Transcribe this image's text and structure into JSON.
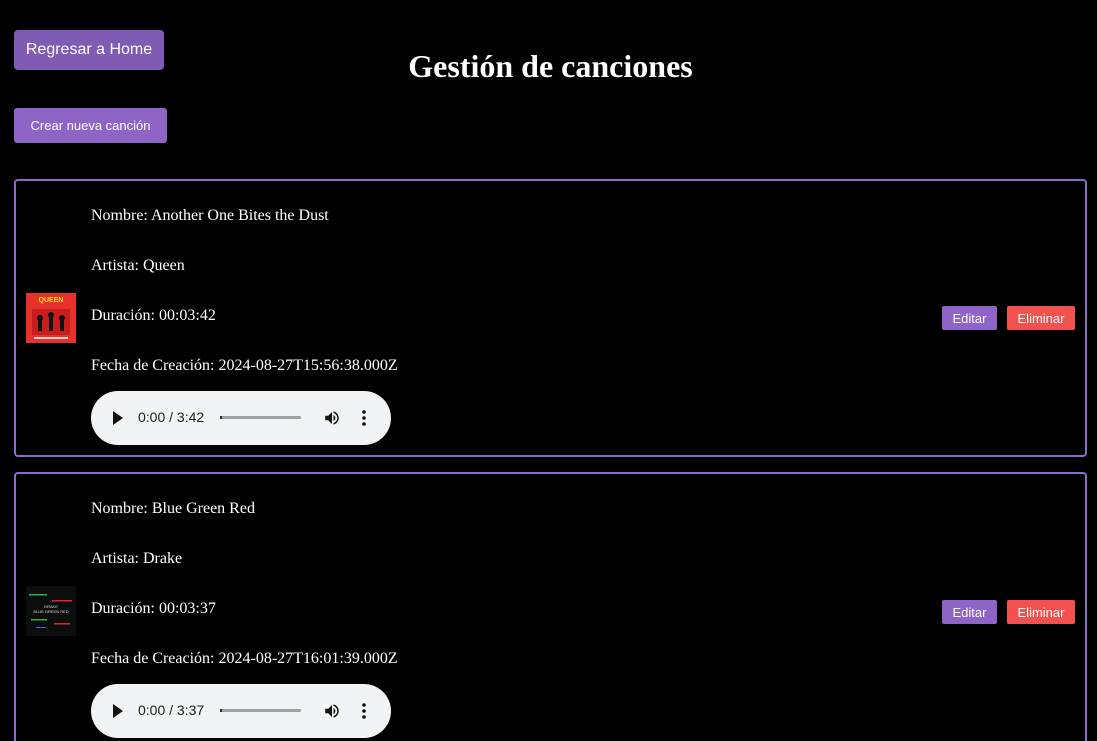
{
  "header": {
    "home_button": "Regresar a Home",
    "title": "Gestión de canciones",
    "create_button": "Crear nueva canción"
  },
  "songs": [
    {
      "name": "Nombre: Another One Bites the Dust",
      "artist": "Artista: Queen",
      "duration": "Duración: 00:03:42",
      "created": "Fecha de Creación: 2024-08-27T15:56:38.000Z",
      "audio_time": "0:00 / 3:42",
      "edit_label": "Editar",
      "delete_label": "Eliminar",
      "cover_text": "QUEEN"
    },
    {
      "name": "Nombre: Blue Green Red",
      "artist": "Artista: Drake",
      "duration": "Duración: 00:03:37",
      "created": "Fecha de Creación: 2024-08-27T16:01:39.000Z",
      "audio_time": "0:00 / 3:37",
      "edit_label": "Editar",
      "delete_label": "Eliminar",
      "cover_text": "DRAKE BLUE GREEN RED"
    }
  ],
  "colors": {
    "accent": "#8e64c6",
    "danger": "#f2524f",
    "background": "#000000"
  }
}
